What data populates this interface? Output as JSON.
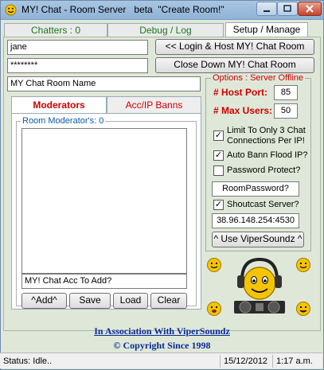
{
  "window": {
    "title": "MY! Chat - Room Server   beta  \"Create Room!\""
  },
  "tabs": [
    {
      "label": "Chatters : 0"
    },
    {
      "label": "Debug / Log"
    },
    {
      "label": "Setup / Manage"
    }
  ],
  "setup": {
    "username_value": "jane",
    "password_value": "********",
    "login_button": "<< Login & Host MY! Chat Room",
    "close_button": "Close Down MY! Chat Room",
    "room_name_value": "MY Chat Room Name"
  },
  "subtabs": [
    {
      "label": "Moderators"
    },
    {
      "label": "Acc/IP Banns"
    }
  ],
  "moderators": {
    "group_label": "Room Moderator's: 0",
    "add_input_value": "MY! Chat Acc To Add?",
    "add_button": "^Add^",
    "save_button": "Save",
    "load_button": "Load",
    "clear_button": "Clear"
  },
  "options": {
    "group_label": "Options : Server Offline",
    "host_port_label": "# Host Port:",
    "host_port_value": "85",
    "max_users_label": "# Max Users:",
    "max_users_value": "50",
    "limit_label_1": "Limit To Only 3 Chat",
    "limit_label_2": "Connections Per IP!",
    "limit_checked": "✓",
    "autobann_label": "Auto Bann Flood IP?",
    "autobann_checked": "✓",
    "password_protect_label": "Password Protect?",
    "room_password_value": "RoomPassword?",
    "shoutcast_label": "Shoutcast Server?",
    "shoutcast_checked": "✓",
    "shoutcast_address": "38.96.148.254:4530",
    "vipersoundz_button": "^ Use ViperSoundz ^"
  },
  "footer": {
    "association": "In Association With ViperSoundz",
    "copyright": "© Copyright Since 1998"
  },
  "status": {
    "text": "Status: Idle..",
    "date": "15/12/2012",
    "time": "1:17 a.m."
  },
  "colors": {
    "accent_red": "#cc0000",
    "link_blue": "#0a2a9a",
    "tab_green": "#1a7a1a"
  }
}
